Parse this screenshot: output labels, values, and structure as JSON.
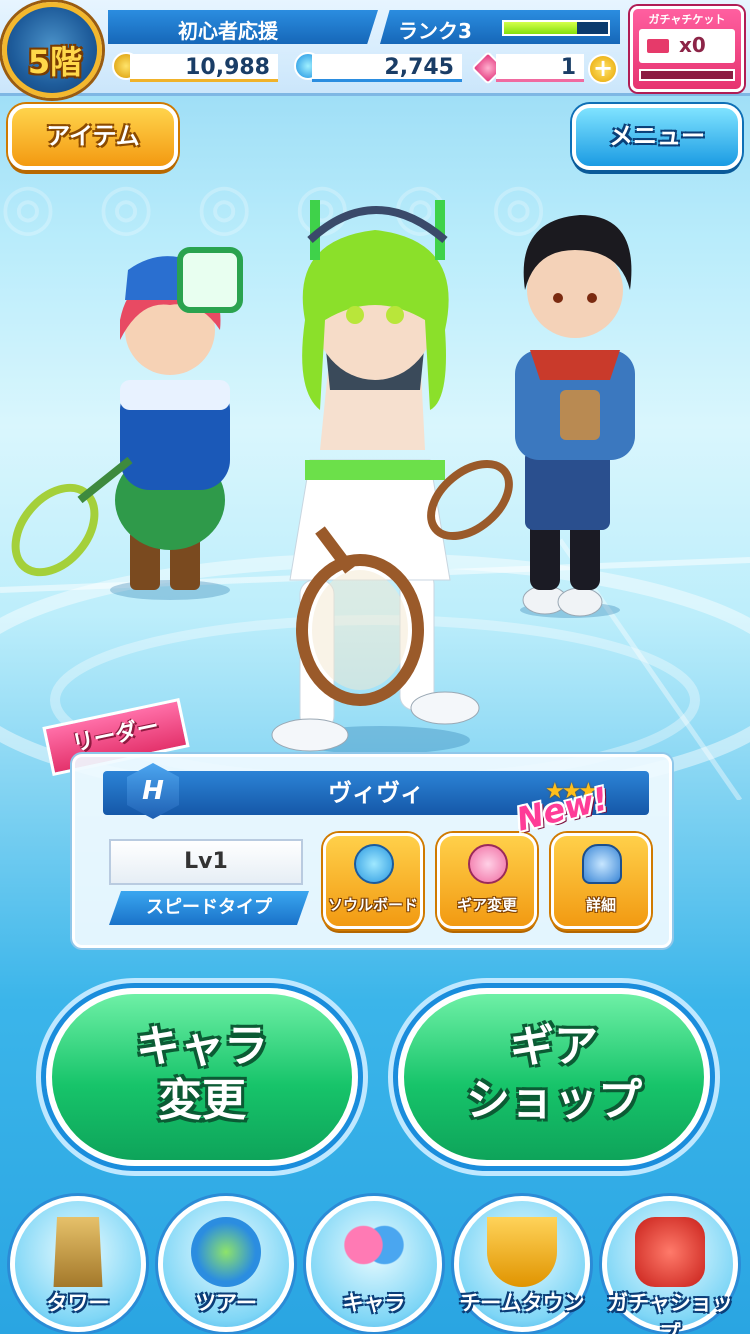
{
  "header": {
    "floor": "5階",
    "title": "初心者応援",
    "rank": "ランク3",
    "rank_progress": 0.7,
    "gold": "10,988",
    "water": "2,745",
    "gems": "1",
    "ticket_label": "ガチャチケット",
    "ticket_count": "x0"
  },
  "top_buttons": {
    "items": "アイテム",
    "menu": "メニュー"
  },
  "leader": {
    "ribbon": "リーダー",
    "rank_letter": "H",
    "name": "ヴィヴィ",
    "stars": "★★★",
    "level": "Lv1",
    "type": "スピードタイプ",
    "new_badge": "New!",
    "buttons": {
      "soul_board": "ソウルボード",
      "gear_change": "ギア変更",
      "details": "詳細"
    }
  },
  "main_buttons": {
    "chara_change": [
      "キャラ",
      "変更"
    ],
    "gear_shop": [
      "ギア",
      "ショップ"
    ]
  },
  "nav": {
    "tower": "タワー",
    "tour": "ツアー",
    "chara": "キャラ",
    "team_town": "チームタウン",
    "gacha_shop": "ガチャショップ"
  },
  "colors": {
    "accent_blue": "#1667b8",
    "button_yellow": "#f39a11",
    "button_green": "#17c46a",
    "ticket_pink": "#e6336f"
  }
}
